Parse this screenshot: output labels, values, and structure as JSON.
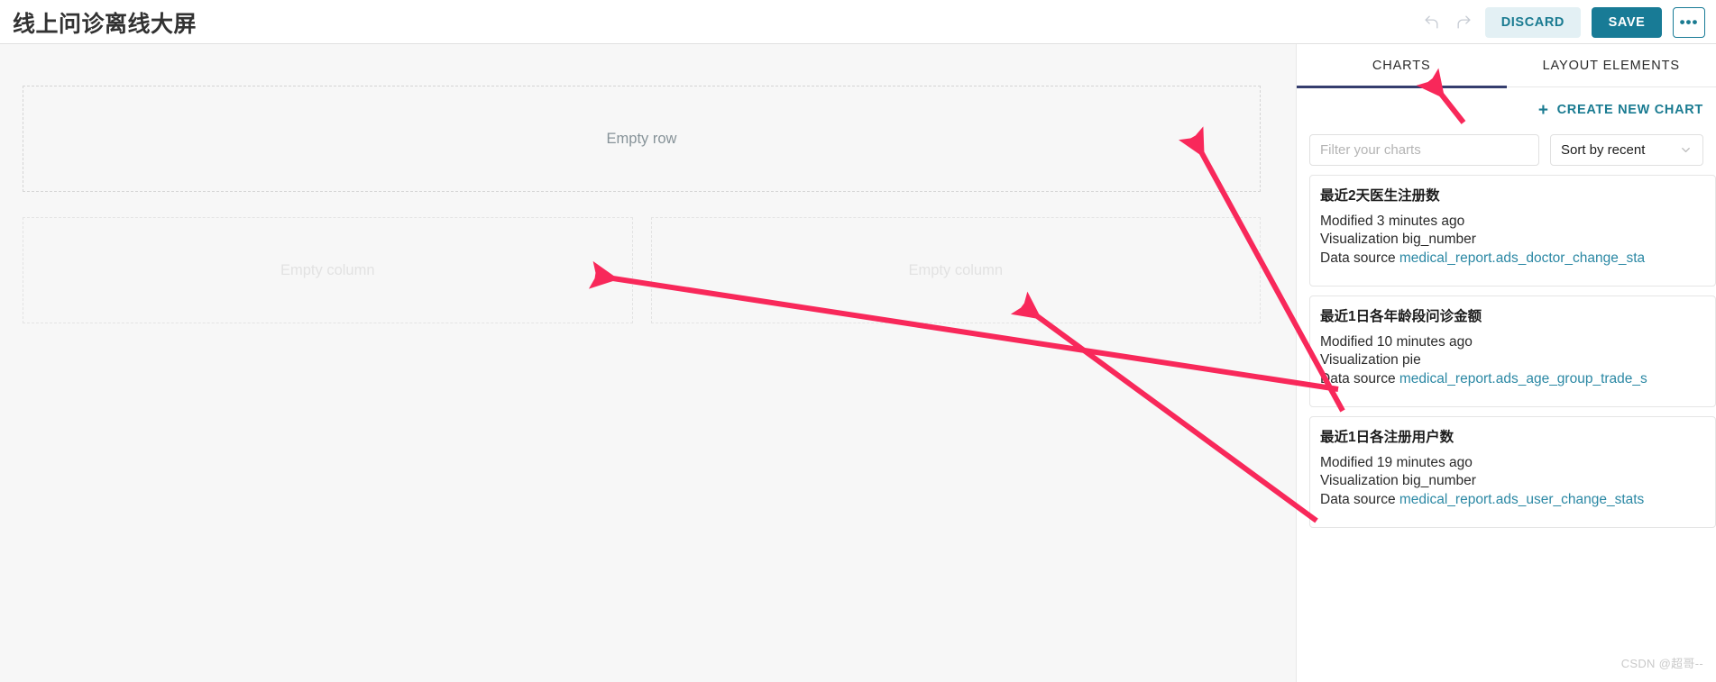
{
  "header": {
    "title": "线上问诊离线大屏",
    "undo_icon": "undo-icon",
    "redo_icon": "redo-icon",
    "discard_label": "DISCARD",
    "save_label": "SAVE",
    "more_label": "•••"
  },
  "canvas": {
    "empty_row_label": "Empty row",
    "empty_columns": [
      {
        "label": "Empty column"
      },
      {
        "label": "Empty column"
      }
    ]
  },
  "panel": {
    "tabs": [
      {
        "label": "CHARTS",
        "active": true
      },
      {
        "label": "LAYOUT ELEMENTS",
        "active": false
      }
    ],
    "create_new_chart_label": "CREATE NEW CHART",
    "create_new_chart_icon": "plus-icon",
    "filter": {
      "value": "",
      "placeholder": "Filter your charts"
    },
    "sort": {
      "selected": "Sort by recent",
      "chevron_icon": "chevron-down-icon"
    },
    "charts": [
      {
        "title": "最近2天医生注册数",
        "modified": "Modified 3 minutes ago",
        "visualization": "Visualization big_number",
        "data_source_label": "Data source",
        "data_source": "medical_report.ads_doctor_change_sta"
      },
      {
        "title": "最近1日各年龄段问诊金额",
        "modified": "Modified 10 minutes ago",
        "visualization": "Visualization pie",
        "data_source_label": "Data source",
        "data_source": "medical_report.ads_age_group_trade_s"
      },
      {
        "title": "最近1日各注册用户数",
        "modified": "Modified 19 minutes ago",
        "visualization": "Visualization big_number",
        "data_source_label": "Data source",
        "data_source": "medical_report.ads_user_change_stats"
      }
    ]
  },
  "watermark": "CSDN @超哥--",
  "colors": {
    "accent_teal": "#187b96",
    "tab_underline": "#353e6e",
    "link_blue": "#2b88a4",
    "annotation_red": "#f8285a"
  }
}
